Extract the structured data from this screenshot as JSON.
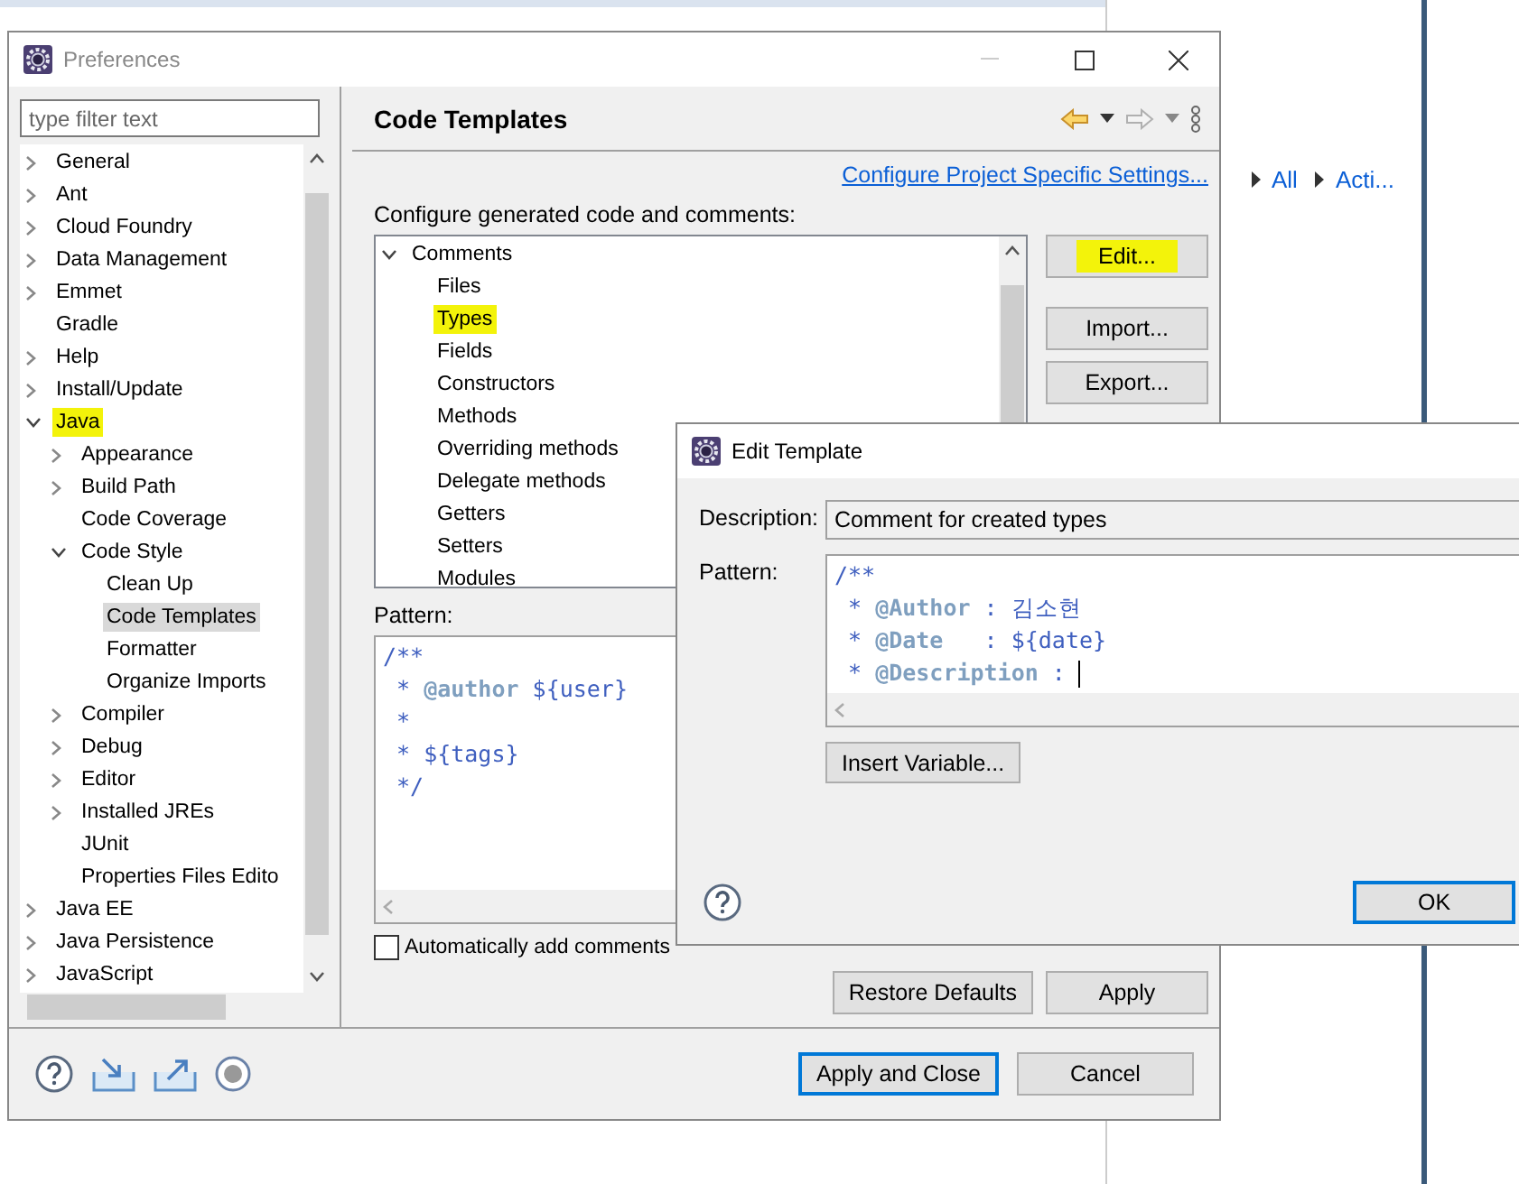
{
  "ide": {
    "outline_links": [
      {
        "label": "All"
      },
      {
        "label": "Acti..."
      }
    ]
  },
  "preferences": {
    "title": "Preferences",
    "filter": {
      "placeholder": "type filter text"
    },
    "tree": [
      {
        "label": "General",
        "kind": "branch",
        "expanded": false,
        "selected": false,
        "marked": false
      },
      {
        "label": "Ant",
        "kind": "branch",
        "expanded": false,
        "selected": false,
        "marked": false
      },
      {
        "label": "Cloud Foundry",
        "kind": "branch",
        "expanded": false,
        "selected": false,
        "marked": false
      },
      {
        "label": "Data Management",
        "kind": "branch",
        "expanded": false,
        "selected": false,
        "marked": false
      },
      {
        "label": "Emmet",
        "kind": "branch",
        "expanded": false,
        "selected": false,
        "marked": false
      },
      {
        "label": "Gradle",
        "kind": "leaf",
        "selected": false,
        "marked": false
      },
      {
        "label": "Help",
        "kind": "branch",
        "expanded": false,
        "selected": false,
        "marked": false
      },
      {
        "label": "Install/Update",
        "kind": "branch",
        "expanded": false,
        "selected": false,
        "marked": false
      },
      {
        "label": "Java",
        "kind": "branch",
        "expanded": true,
        "selected": false,
        "marked": true,
        "children": [
          {
            "label": "Appearance",
            "kind": "branch",
            "expanded": false,
            "selected": false,
            "marked": false
          },
          {
            "label": "Build Path",
            "kind": "branch",
            "expanded": false,
            "selected": false,
            "marked": false
          },
          {
            "label": "Code Coverage",
            "kind": "leaf",
            "selected": false,
            "marked": false
          },
          {
            "label": "Code Style",
            "kind": "branch",
            "expanded": true,
            "selected": false,
            "marked": false,
            "children": [
              {
                "label": "Clean Up",
                "kind": "leaf",
                "selected": false,
                "marked": false
              },
              {
                "label": "Code Templates",
                "kind": "leaf",
                "selected": true,
                "marked": false
              },
              {
                "label": "Formatter",
                "kind": "leaf",
                "selected": false,
                "marked": false
              },
              {
                "label": "Organize Imports",
                "kind": "leaf",
                "selected": false,
                "marked": false
              }
            ]
          },
          {
            "label": "Compiler",
            "kind": "branch",
            "expanded": false,
            "selected": false,
            "marked": false
          },
          {
            "label": "Debug",
            "kind": "branch",
            "expanded": false,
            "selected": false,
            "marked": false
          },
          {
            "label": "Editor",
            "kind": "branch",
            "expanded": false,
            "selected": false,
            "marked": false
          },
          {
            "label": "Installed JREs",
            "kind": "branch",
            "expanded": false,
            "selected": false,
            "marked": false
          },
          {
            "label": "JUnit",
            "kind": "leaf",
            "selected": false,
            "marked": false
          },
          {
            "label": "Properties Files Edito",
            "kind": "leaf",
            "selected": false,
            "marked": false
          }
        ]
      },
      {
        "label": "Java EE",
        "kind": "branch",
        "expanded": false,
        "selected": false,
        "marked": false
      },
      {
        "label": "Java Persistence",
        "kind": "branch",
        "expanded": false,
        "selected": false,
        "marked": false
      },
      {
        "label": "JavaScript",
        "kind": "branch",
        "expanded": false,
        "selected": false,
        "marked": false
      }
    ],
    "page_title": "Code Templates",
    "project_link": "Configure Project Specific Settings...",
    "intro": "Configure generated code and comments:",
    "templates": [
      {
        "label": "Comments",
        "kind": "branch",
        "expanded": true,
        "selected": false,
        "marked": false,
        "children": [
          {
            "label": "Files",
            "kind": "leaf",
            "selected": false,
            "marked": false
          },
          {
            "label": "Types",
            "kind": "leaf",
            "selected": false,
            "marked": true
          },
          {
            "label": "Fields",
            "kind": "leaf",
            "selected": false,
            "marked": false
          },
          {
            "label": "Constructors",
            "kind": "leaf",
            "selected": false,
            "marked": false
          },
          {
            "label": "Methods",
            "kind": "leaf",
            "selected": false,
            "marked": false
          },
          {
            "label": "Overriding methods",
            "kind": "leaf",
            "selected": false,
            "marked": false
          },
          {
            "label": "Delegate methods",
            "kind": "leaf",
            "selected": false,
            "marked": false
          },
          {
            "label": "Getters",
            "kind": "leaf",
            "selected": false,
            "marked": false
          },
          {
            "label": "Setters",
            "kind": "leaf",
            "selected": false,
            "marked": false
          },
          {
            "label": "Modules",
            "kind": "leaf",
            "selected": false,
            "marked": false
          }
        ]
      }
    ],
    "side_buttons": [
      {
        "label": "Edit...",
        "marked": true
      },
      {
        "label": "Import...",
        "marked": false
      },
      {
        "label": "Export...",
        "marked": false
      }
    ],
    "pattern_label": "Pattern:",
    "pattern": [
      [
        {
          "kind": "comment",
          "text": "/**"
        }
      ],
      [
        {
          "kind": "comment",
          "text": " * "
        },
        {
          "kind": "tag",
          "text": "@author"
        },
        {
          "kind": "var",
          "text": " ${user}"
        }
      ],
      [
        {
          "kind": "comment",
          "text": " *"
        }
      ],
      [
        {
          "kind": "comment",
          "text": " * "
        },
        {
          "kind": "var",
          "text": "${tags}"
        }
      ],
      [
        {
          "kind": "comment",
          "text": " */"
        }
      ]
    ],
    "auto_comments": {
      "label": "Automatically add comments",
      "checked": false
    },
    "restore_button": "Restore Defaults",
    "apply_button": "Apply",
    "apply_close_button": "Apply and Close",
    "cancel_button": "Cancel"
  },
  "edit_template": {
    "title": "Edit Template",
    "description_label": "Description:",
    "description": "Comment for created types",
    "pattern_label": "Pattern:",
    "pattern": [
      [
        {
          "kind": "comment",
          "text": "/**"
        }
      ],
      [
        {
          "kind": "comment",
          "text": " * "
        },
        {
          "kind": "tag",
          "text": "@Author"
        },
        {
          "kind": "comment",
          "text": " : 김소현"
        }
      ],
      [
        {
          "kind": "comment",
          "text": " * "
        },
        {
          "kind": "tag",
          "text": "@Date"
        },
        {
          "kind": "comment",
          "text": "   : "
        },
        {
          "kind": "var",
          "text": "${date}"
        }
      ],
      [
        {
          "kind": "comment",
          "text": " * "
        },
        {
          "kind": "tag",
          "text": "@Description"
        },
        {
          "kind": "comment",
          "text": " : "
        }
      ]
    ],
    "insert_button": "Insert Variable...",
    "ok_button": "OK"
  }
}
